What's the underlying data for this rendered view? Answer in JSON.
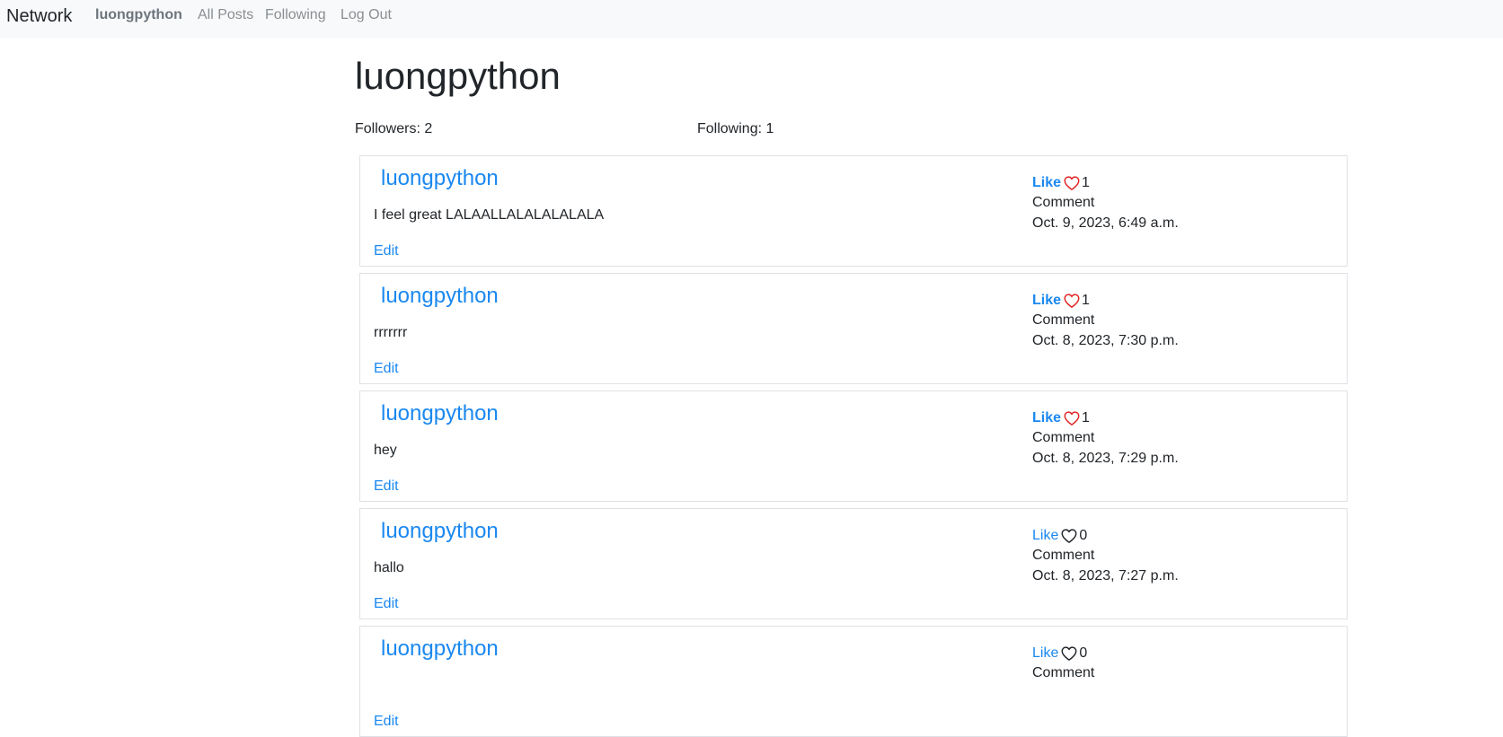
{
  "nav": {
    "brand": "Network",
    "user": "luongpython",
    "all_posts": "All Posts",
    "following": "Following",
    "logout": "Log Out"
  },
  "profile": {
    "username": "luongpython",
    "followers": "Followers: 2",
    "following": "Following: 1"
  },
  "posts": [
    {
      "user": "luongpython",
      "content": "I feel great LALAALLALALALALALA",
      "edit": "Edit",
      "like_label": "Like",
      "likes": "1",
      "liked": true,
      "comment": "Comment",
      "timestamp": "Oct. 9, 2023, 6:49 a.m."
    },
    {
      "user": "luongpython",
      "content": "rrrrrrr",
      "edit": "Edit",
      "like_label": "Like",
      "likes": "1",
      "liked": true,
      "comment": "Comment",
      "timestamp": "Oct. 8, 2023, 7:30 p.m."
    },
    {
      "user": "luongpython",
      "content": "hey",
      "edit": "Edit",
      "like_label": "Like",
      "likes": "1",
      "liked": true,
      "comment": "Comment",
      "timestamp": "Oct. 8, 2023, 7:29 p.m."
    },
    {
      "user": "luongpython",
      "content": "hallo",
      "edit": "Edit",
      "like_label": "Like",
      "likes": "0",
      "liked": false,
      "comment": "Comment",
      "timestamp": "Oct. 8, 2023, 7:27 p.m."
    },
    {
      "user": "luongpython",
      "content": "",
      "edit": "Edit",
      "like_label": "Like",
      "likes": "0",
      "liked": false,
      "comment": "Comment",
      "timestamp": ""
    }
  ],
  "colors": {
    "link": "#1a88f0",
    "heart_liked": "#e02424",
    "heart_unliked": "#212529"
  }
}
